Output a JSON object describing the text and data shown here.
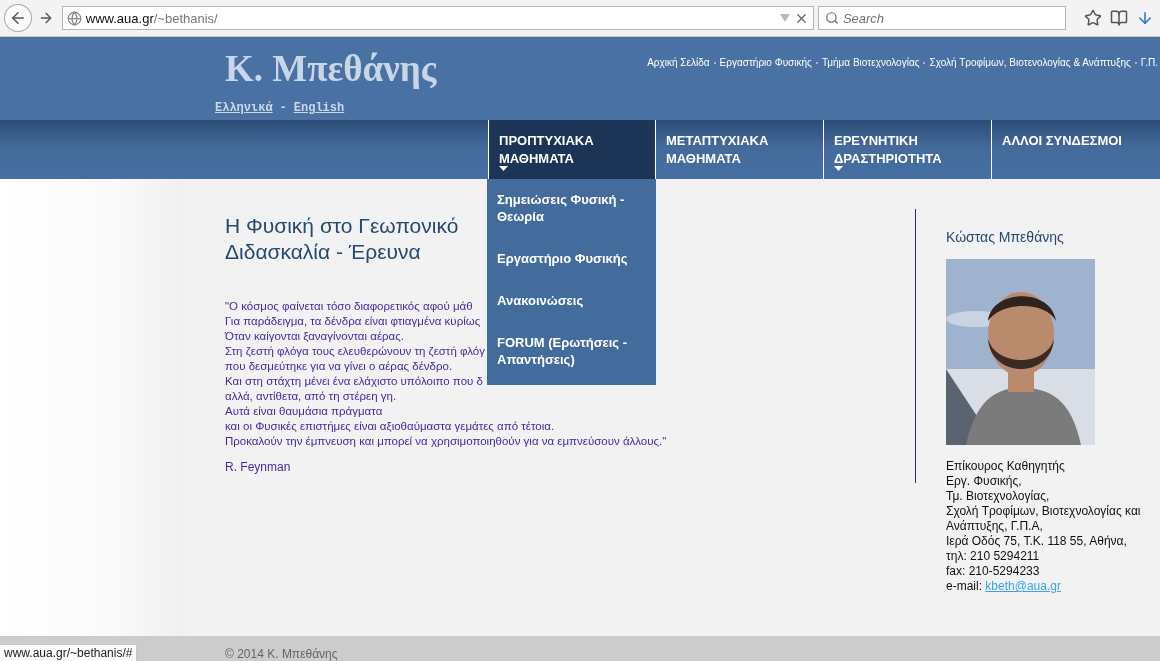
{
  "browser": {
    "url_host": "www.aua.gr",
    "url_path": "/~bethanis/",
    "search_placeholder": "Search",
    "status_url": "www.aua.gr/~bethanis/#"
  },
  "header": {
    "site_title": "Κ. Μπεθάνης",
    "top_links": [
      "Αρχική Σελίδα",
      "Εργαστήριο Φυσικής",
      "Τμήμα Βιοτεχνολογίας",
      "Σχολή Τροφίμων, Βιοτενολογίας & Ανάπτυξης",
      "Γ.Π."
    ],
    "languages": [
      "Ελληνικά",
      "English"
    ],
    "language_separator": "-"
  },
  "nav": [
    {
      "label": "ΠΡΟΠΤΥΧΙΑΚΑ ΜΑΘΗΜΑΤΑ",
      "selected": true,
      "has_submenu": true,
      "submenu": [
        "Σημειώσεις Φυσική - Θεωρία",
        "Εργαστήριο Φυσικής",
        "Ανακοινώσεις",
        "FORUM (Ερωτήσεις - Απαντήσεις)"
      ]
    },
    {
      "label": "ΜΕΤΑΠΤΥΧΙΑΚΑ ΜΑΘΗΜΑΤΑ",
      "selected": false,
      "has_submenu": false
    },
    {
      "label": "ΕΡΕΥΝΗΤΙΚΗ ΔΡΑΣΤΗΡΙΟΤΗΤΑ",
      "selected": false,
      "has_submenu": true
    },
    {
      "label": "ΑΛΛΟΙ ΣΥΝΔΕΣΜΟΙ",
      "selected": false,
      "has_submenu": false
    }
  ],
  "article": {
    "title_lines": [
      "Η Φυσική στο Γεωπονικό",
      "Διδασκαλία - Έρευνα"
    ],
    "quote_lines": [
      "\"Ο κόσμος φαίνεται τόσο διαφορετικός αφού μάθ",
      "Για παράδειγμα, τα δένδρα είναι φτιαγμένα κυρίως",
      "Όταν καίγονται ξαναγίνονται αέρας.",
      "Στη ζεστή φλόγα τους ελευθερώνουν τη ζεστή φλόγ",
      "που δεσμεύτηκε για να γίνει ο αέρας δένδρο.",
      "Και στη στάχτη μένει ένα ελάχιστο υπόλοιπο που δ",
      "αλλά, αντίθετα, από τη στέρεη γη.",
      "Αυτά είναι θαυμάσια πράγματα",
      "και οι Φυσικές επιστήμες είναι αξιοθαύμαστα γεμάτες από τέτοια.",
      "Προκαλούν την έμπνευση και μπορεί να χρησιμοποιηθούν για να εμπνεύσουν άλλους.\""
    ],
    "author": "R. Feynman"
  },
  "profile": {
    "name": "Κώστας Μπεθάνης",
    "details": [
      "Επίκουρος Καθηγητής",
      "Εργ. Φυσικής,",
      "Τμ. Βιοτεχνολογίας,",
      "Σχολή Τροφίμων, Βιοτεχνολογίας και Ανάπτυξης, Γ.Π.Α,",
      "Ιερά Οδός 75, Τ.Κ. 118 55, Αθήνα,",
      "τηλ: 210 5294211",
      "fax: 210-5294233"
    ],
    "email_label": "e-mail:",
    "email": "kbeth@aua.gr"
  },
  "footer": {
    "copyright": "© 2014 Κ. Μπεθάνης"
  }
}
